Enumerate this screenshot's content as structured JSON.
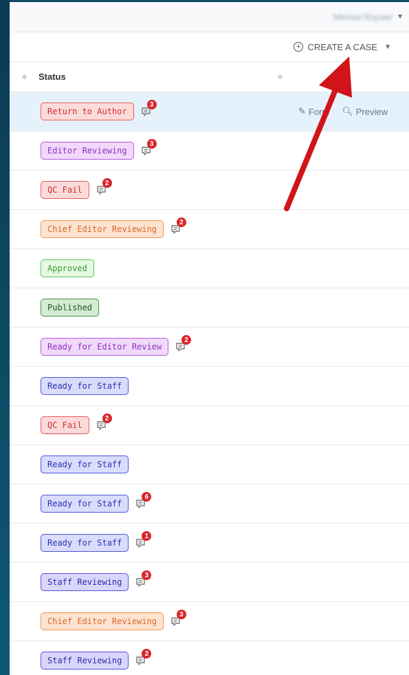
{
  "topbar": {
    "user_name": "Michael Royster"
  },
  "actionbar": {
    "create_case_label": "CREATE A CASE"
  },
  "table": {
    "header_status": "Status",
    "row_actions": {
      "form_label": "Form",
      "preview_label": "Preview"
    },
    "rows": [
      {
        "status": "Return to Author",
        "color": "red",
        "comments": "3",
        "selected": true
      },
      {
        "status": "Editor Reviewing",
        "color": "purple",
        "comments": "3"
      },
      {
        "status": "QC Fail",
        "color": "red",
        "comments": "2"
      },
      {
        "status": "Chief Editor Reviewing",
        "color": "orange",
        "comments": "2"
      },
      {
        "status": "Approved",
        "color": "green",
        "comments": ""
      },
      {
        "status": "Published",
        "color": "dgreen",
        "comments": ""
      },
      {
        "status": "Ready for Editor Review",
        "color": "purple",
        "comments": "2"
      },
      {
        "status": "Ready for Staff",
        "color": "blue",
        "comments": ""
      },
      {
        "status": "QC Fail",
        "color": "red",
        "comments": "2"
      },
      {
        "status": "Ready for Staff",
        "color": "blue",
        "comments": ""
      },
      {
        "status": "Ready for Staff",
        "color": "blue",
        "comments": "6"
      },
      {
        "status": "Ready for Staff",
        "color": "blue",
        "comments": "1"
      },
      {
        "status": "Staff Reviewing",
        "color": "purple-blue",
        "comments": "3"
      },
      {
        "status": "Chief Editor Reviewing",
        "color": "orange",
        "comments": "3"
      },
      {
        "status": "Staff Reviewing",
        "color": "purple-blue",
        "comments": "2"
      }
    ]
  },
  "annotation": {
    "arrow_color": "#d0141a"
  }
}
